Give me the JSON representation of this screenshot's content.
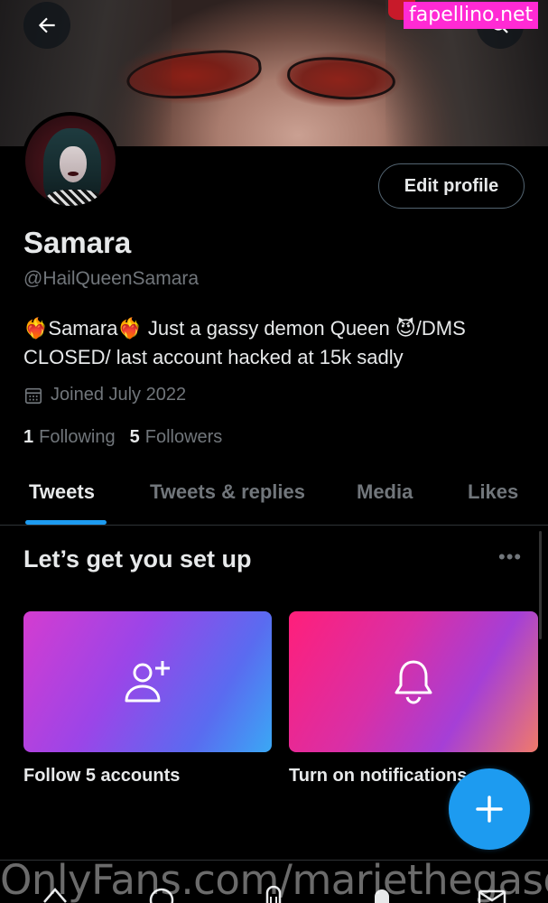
{
  "watermark_top": "fapellino.net",
  "watermark_bottom": "OnlyFans.com/mariethegasqueen",
  "header": {
    "back_icon": "arrow-left-icon",
    "search_icon": "search-icon"
  },
  "profile": {
    "name": "Samara",
    "handle": "@HailQueenSamara",
    "bio": "❤️‍🔥Samara❤️‍🔥 Just a gassy demon Queen 😈/DMS CLOSED/ last account hacked at 15k sadly",
    "joined": "Joined July 2022",
    "edit_label": "Edit profile",
    "following_count": "1",
    "following_label": "Following",
    "followers_count": "5",
    "followers_label": "Followers"
  },
  "tabs": [
    {
      "label": "Tweets",
      "active": true
    },
    {
      "label": "Tweets & replies",
      "active": false
    },
    {
      "label": "Media",
      "active": false
    },
    {
      "label": "Likes",
      "active": false
    }
  ],
  "setup": {
    "title": "Let’s get you set up",
    "more_label": "•••",
    "cards": [
      {
        "label": "Follow 5 accounts",
        "icon": "add-user-icon"
      },
      {
        "label": "Turn on notifications",
        "icon": "bell-icon"
      }
    ]
  },
  "fab_icon": "plus-icon",
  "colors": {
    "accent": "#1d9bf0",
    "background": "#000000",
    "secondary_text": "#71767b",
    "watermark": "#ff2ad4"
  }
}
